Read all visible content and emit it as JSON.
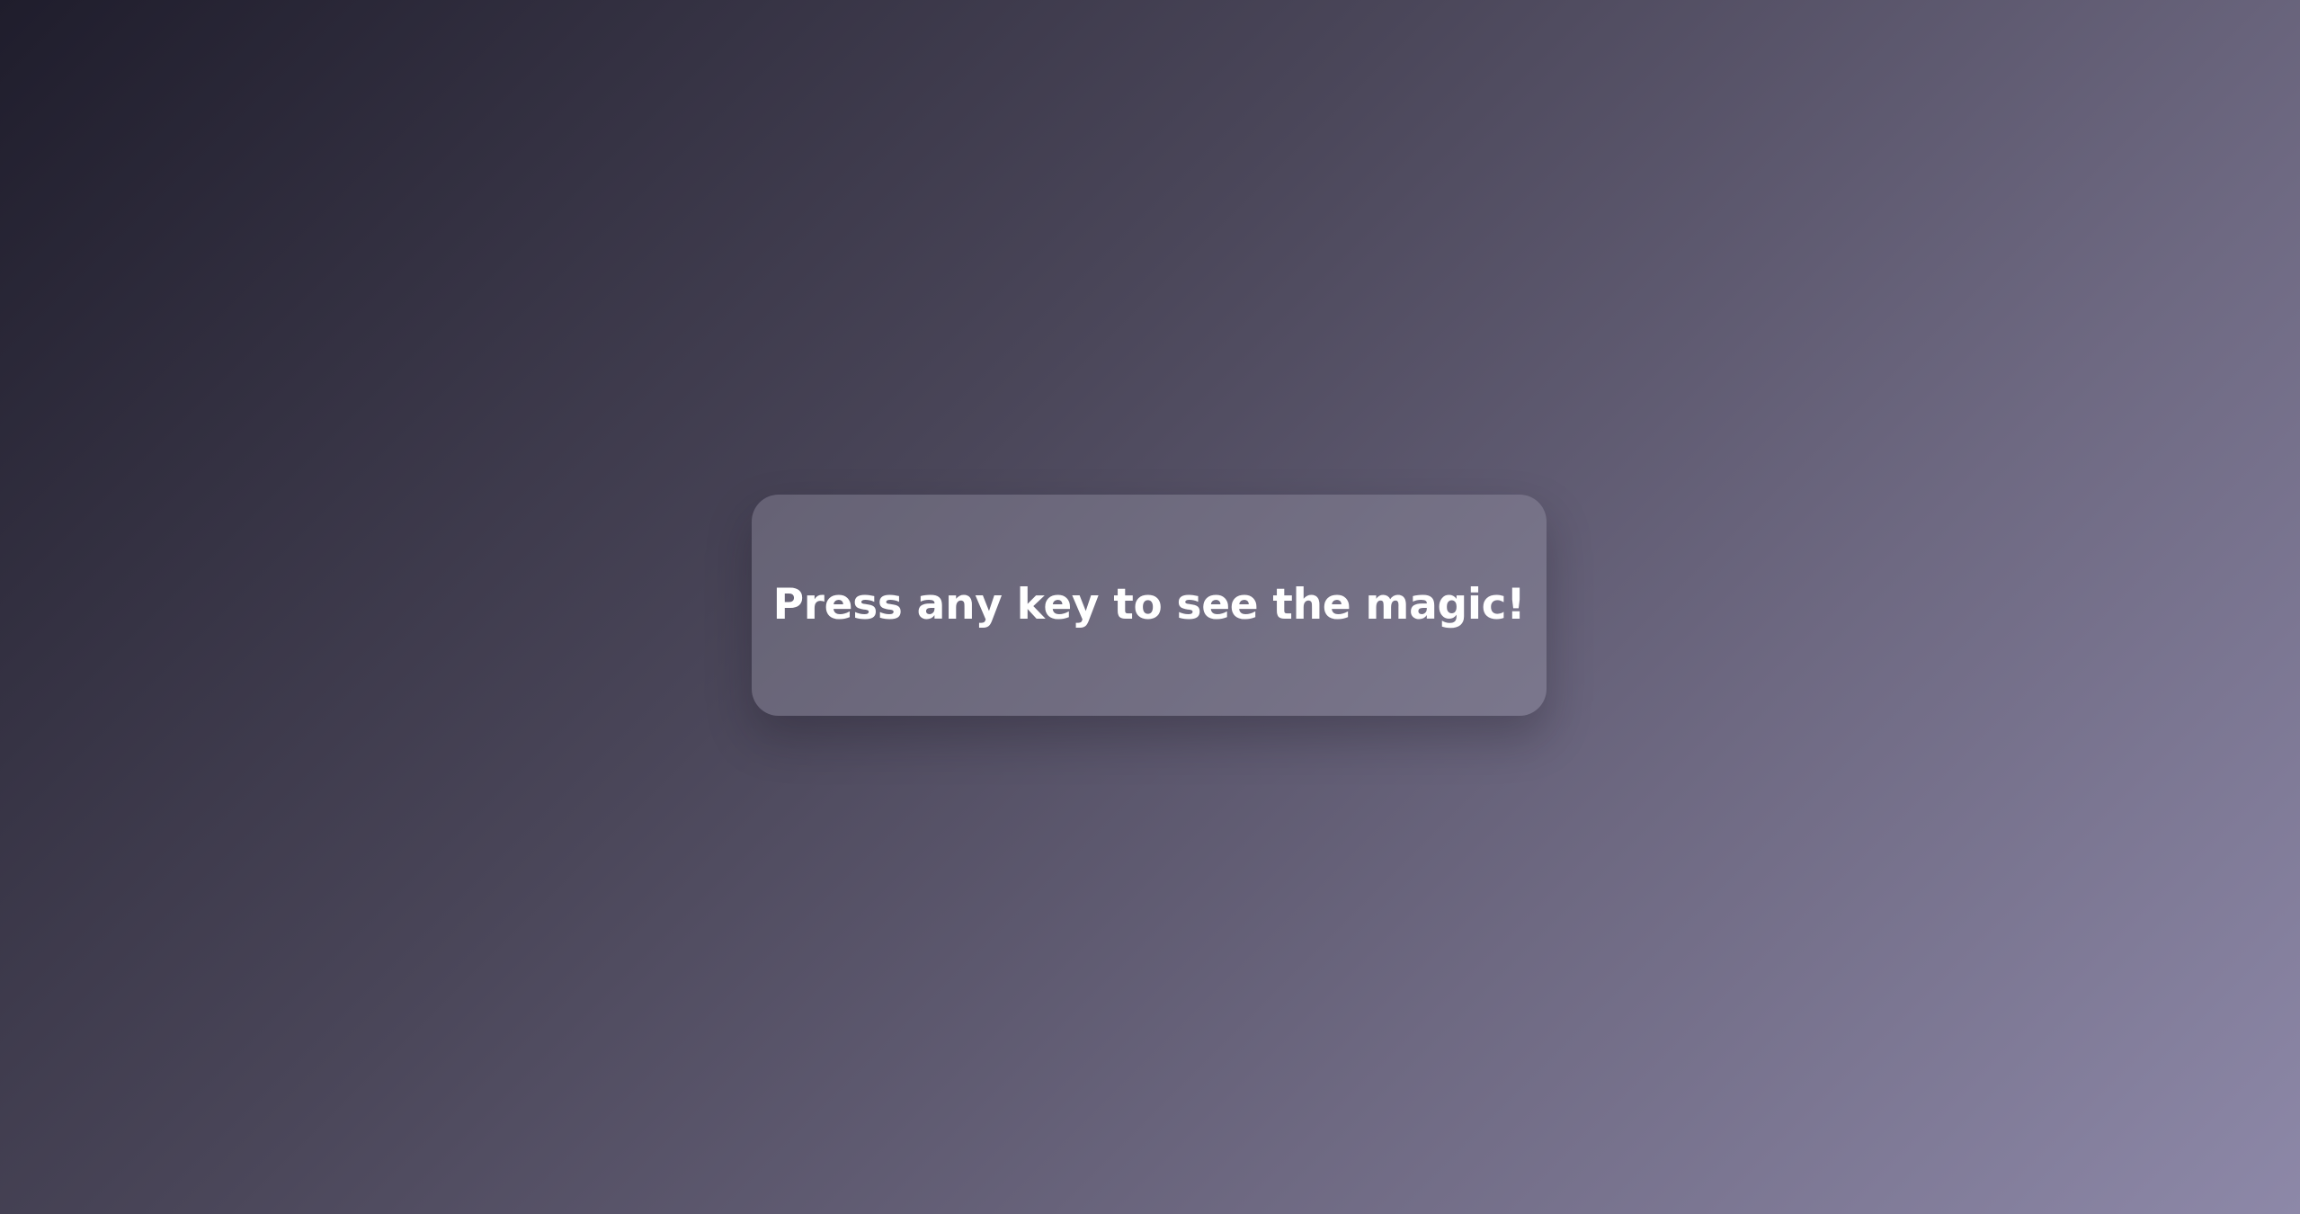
{
  "card": {
    "message": "Press any key to see the magic!"
  },
  "colors": {
    "background_start": "#1f1d2c",
    "background_end": "#8d88a8",
    "card_background": "rgba(155,152,172,0.38)",
    "text": "#ffffff"
  }
}
